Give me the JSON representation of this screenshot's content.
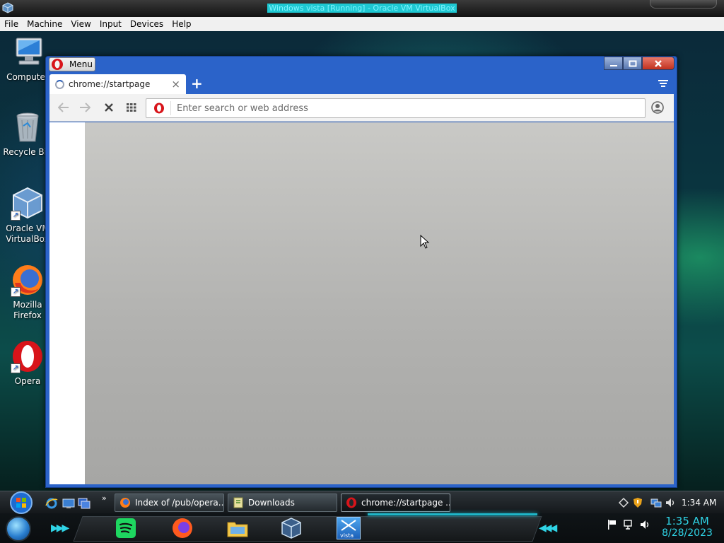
{
  "host": {
    "title": "Windows vista [Running] - Oracle VM VirtualBox",
    "menu": [
      "File",
      "Machine",
      "View",
      "Input",
      "Devices",
      "Help"
    ]
  },
  "desktop_icons": [
    {
      "label": "Computer",
      "icon": "computer-icon"
    },
    {
      "label": "Recycle Bin",
      "icon": "recycle-bin-icon"
    },
    {
      "label": "Oracle VM VirtualBox",
      "icon": "virtualbox-icon"
    },
    {
      "label": "Mozilla Firefox",
      "icon": "firefox-icon"
    },
    {
      "label": "Opera",
      "icon": "opera-icon"
    }
  ],
  "browser": {
    "menu_label": "Menu",
    "tab_title": "chrome://startpage",
    "address_placeholder": "Enter search or web address"
  },
  "taskbar": {
    "tasks": [
      {
        "label": "Index of /pub/opera...",
        "icon": "firefox-icon"
      },
      {
        "label": "Downloads",
        "icon": "folder-icon"
      },
      {
        "label": "chrome://startpage ...",
        "icon": "opera-icon",
        "active": true
      }
    ],
    "tray_time": "1:34 AM",
    "dock_time": "1:35 AM",
    "dock_date": "8/28/2023",
    "dock_badge": "vista"
  },
  "colors": {
    "window_frame": "#2b63c9",
    "opera_red": "#d8141a",
    "accent_cyan": "#2fd4e6"
  }
}
